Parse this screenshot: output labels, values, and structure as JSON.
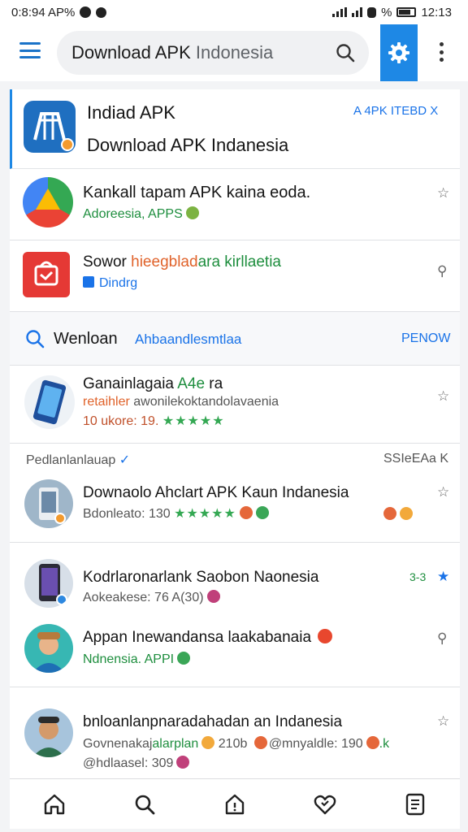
{
  "status": {
    "time_left": "0:8:94 AP%",
    "right_pct": "%",
    "time_right": "12:13"
  },
  "search": {
    "query_dark": "Download APK",
    "query_hint": " Indonesia"
  },
  "header_card": {
    "title": "Indiad APK",
    "subtitle": "Download APK Indanesia",
    "action": "A 4PK ITEBD X"
  },
  "apps": [
    {
      "title": "Kankall tapam APK kaina eoda.",
      "meta": "Adoreesia, APPS",
      "meta_color": "green"
    },
    {
      "title_dark": "Sowor ",
      "title_orange": "hieegblad",
      "title_green": "ara kirllaetia",
      "meta": "Dindrg",
      "meta_color": "blue"
    }
  ],
  "filter": {
    "label": "Wenloan",
    "query": "Ahbaandlesmtlaa",
    "action": "PENOW"
  },
  "phone_item": {
    "title": "Ganainlagaia ",
    "title_green": "A4e",
    "title_tail": " ra",
    "line2_orange": "retaihler",
    "line2_rest": " awonilekoktandolavaenia",
    "rating_prefix": "10 ukore: 19.",
    "stars": "★★★★★"
  },
  "section": {
    "title": "Pedlanlanlauap",
    "action": "SSIeEAa K"
  },
  "list_items": [
    {
      "title": "Downaolo Ahclart APK Kaun Indanesia",
      "meta": "Bdonleato: 130 ",
      "stars": "★★★★★"
    },
    {
      "title": "Kodrlaronarlank Saobon Naonesia",
      "meta": "Aokeakese: 76 A(30)",
      "right": "3-3"
    },
    {
      "title": "Appan Inewandansa laakabanaia",
      "meta": "Ndnensia. APPI",
      "meta_color": "green"
    },
    {
      "title": "bnloanlanpnaradahadan an Indanesia",
      "meta_a": "Govnenakaj",
      "meta_b": "alarplan",
      "meta_c": " 210b ",
      "meta_d": "@mnyaldle: 190",
      "meta_e": ".k",
      "meta_line3": "@hdlaasel: 309"
    }
  ],
  "colors": {
    "accent": "#1e88e5",
    "green": "#1e8e3e",
    "star_yellow": "#f5b400"
  }
}
